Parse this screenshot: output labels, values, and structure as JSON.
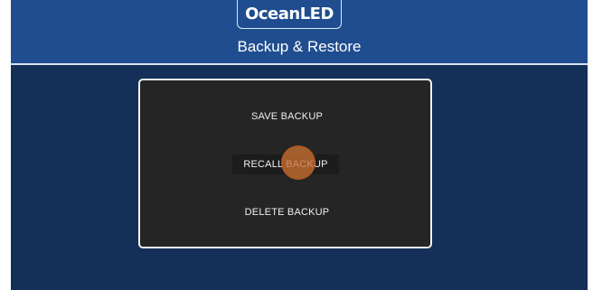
{
  "header": {
    "logo_text": "OceanLED",
    "title": "Backup & Restore"
  },
  "panel": {
    "save_label": "SAVE BACKUP",
    "recall_label": "RECALL BACKUP",
    "delete_label": "DELETE BACKUP"
  },
  "colors": {
    "header_bg": "#1f4d8f",
    "body_bg": "#143059",
    "panel_bg": "#252525",
    "touch_indicator": "#c87032"
  }
}
